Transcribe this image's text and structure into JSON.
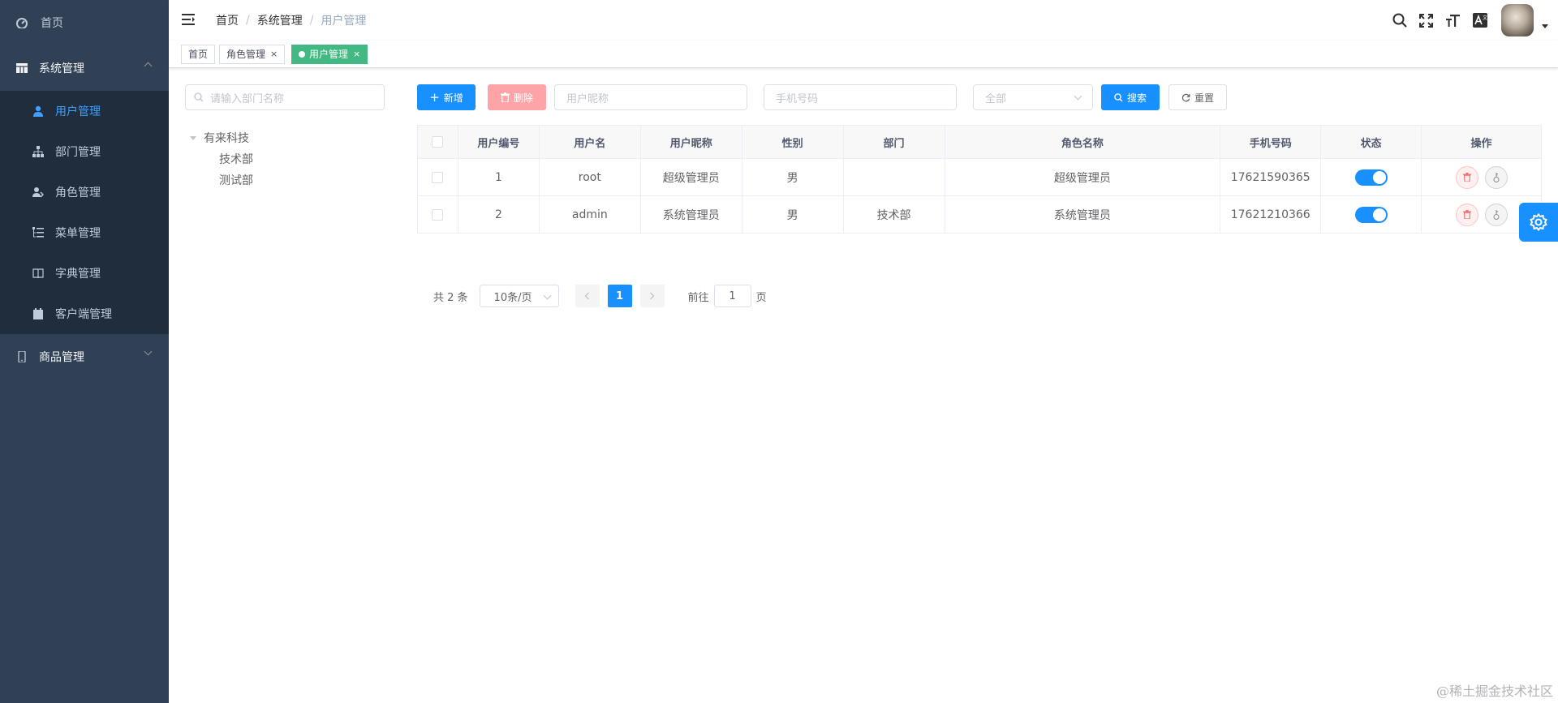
{
  "sidebar": {
    "home": "首页",
    "system_group": "系统管理",
    "items": [
      {
        "label": "用户管理",
        "active": true
      },
      {
        "label": "部门管理"
      },
      {
        "label": "角色管理"
      },
      {
        "label": "菜单管理"
      },
      {
        "label": "字典管理"
      },
      {
        "label": "客户端管理"
      }
    ],
    "goods_group": "商品管理"
  },
  "breadcrumb": [
    "首页",
    "系统管理",
    "用户管理"
  ],
  "tags": [
    {
      "label": "首页"
    },
    {
      "label": "角色管理",
      "close": "×"
    },
    {
      "label": "用户管理",
      "close": "×",
      "active": true
    }
  ],
  "dept_tree": {
    "search_placeholder": "请输入部门名称",
    "root": "有来科技",
    "children": [
      "技术部",
      "测试部"
    ]
  },
  "toolbar": {
    "add_label": "新增",
    "delete_label": "删除",
    "nickname_placeholder": "用户昵称",
    "mobile_placeholder": "手机号码",
    "status_placeholder": "全部",
    "search_label": "搜索",
    "reset_label": "重置"
  },
  "table": {
    "headers": [
      "用户编号",
      "用户名",
      "用户昵称",
      "性别",
      "部门",
      "角色名称",
      "手机号码",
      "状态",
      "操作"
    ],
    "rows": [
      {
        "id": "1",
        "username": "root",
        "nickname": "超级管理员",
        "gender": "男",
        "dept": "",
        "role": "超级管理员",
        "mobile": "17621590365",
        "status": true
      },
      {
        "id": "2",
        "username": "admin",
        "nickname": "系统管理员",
        "gender": "男",
        "dept": "技术部",
        "role": "系统管理员",
        "mobile": "17621210366",
        "status": true
      }
    ]
  },
  "pagination": {
    "total": "共 2 条",
    "page_size": "10条/页",
    "current": "1",
    "goto_label": "前往",
    "goto_value": "1",
    "page_suffix": "页"
  },
  "watermark": "@稀土掘金技术社区",
  "colors": {
    "primary": "#1890ff",
    "sidebar": "#304156",
    "tag_active": "#42b983",
    "danger": "#ffa4a6"
  }
}
